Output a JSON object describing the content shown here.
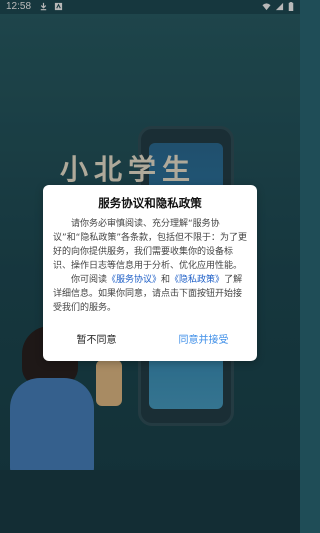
{
  "status_bar": {
    "time": "12:58",
    "left_icons": [
      "download-icon",
      "app-notification-icon"
    ],
    "right_icons": [
      "wifi-icon",
      "signal-icon",
      "battery-icon"
    ]
  },
  "background": {
    "title_text": "小北学生"
  },
  "dialog": {
    "title": "服务协议和隐私政策",
    "para1": "请你务必审慎阅读、充分理解“服务协议”和“隐私政策”各条款，包括但不限于：为了更好的向你提供服务，我们需要收集你的设备标识、操作日志等信息用于分析、优化应用性能。",
    "para2_prefix": "你可阅读",
    "link_service": "《服务协议》",
    "para2_and": "和",
    "link_privacy": "《隐私政策》",
    "para2_suffix": "了解详细信息。如果你同意，请点击下面按钮开始接受我们的服务。",
    "decline_label": "暂不同意",
    "accept_label": "同意并接受"
  },
  "colors": {
    "background": "#1f4d57",
    "link": "#1e5fc7",
    "accept": "#3d8ee8"
  }
}
